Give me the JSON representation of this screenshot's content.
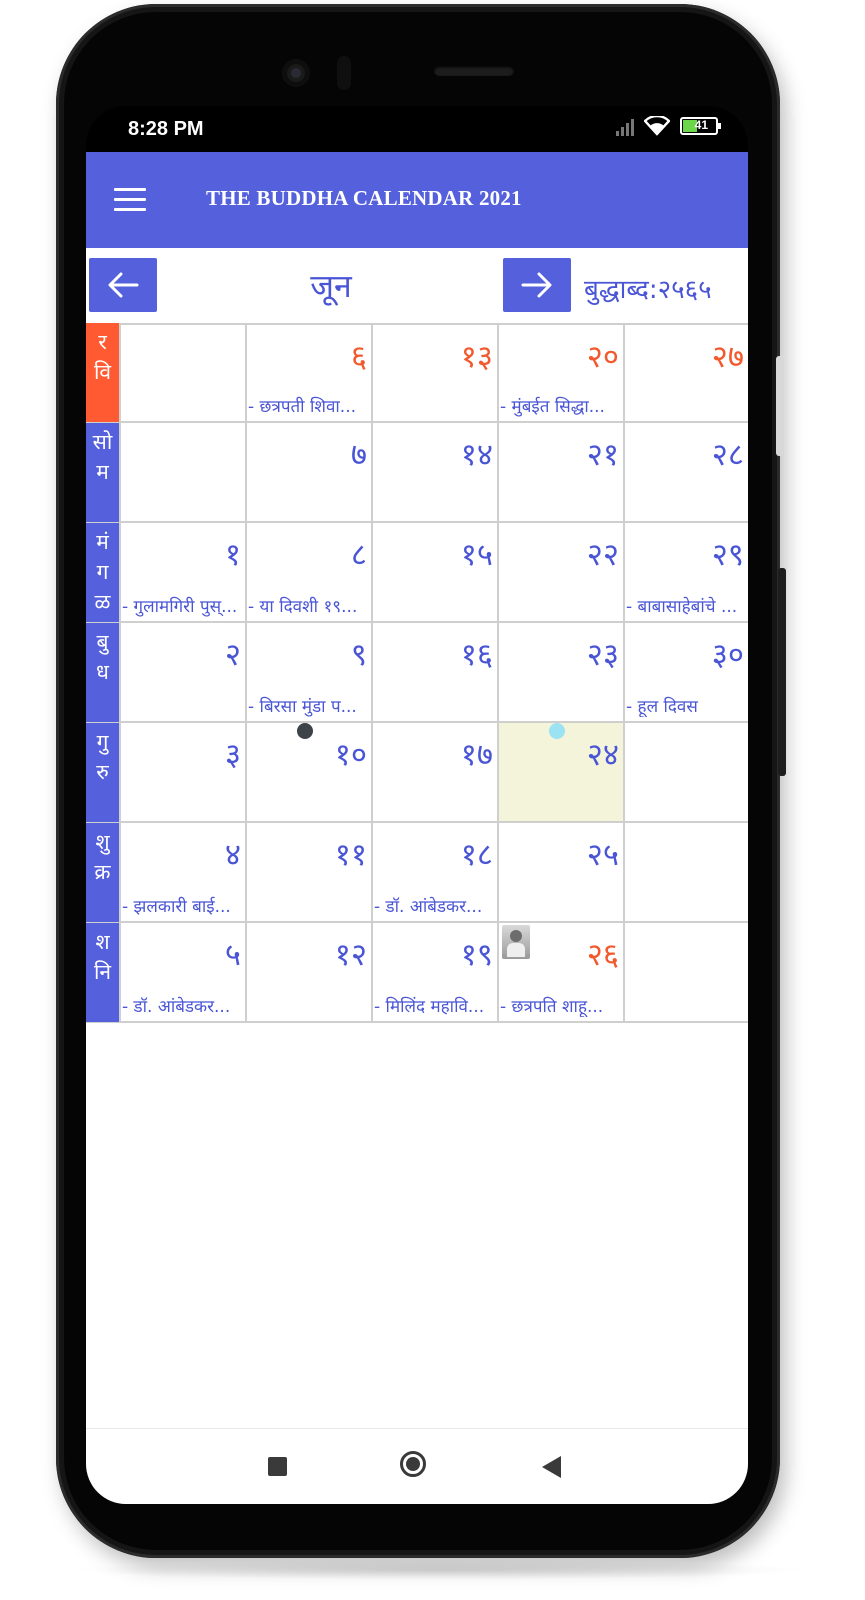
{
  "status": {
    "time": "8:28 PM",
    "battery": "41"
  },
  "appbar": {
    "title": "THE BUDDHA CALENDAR 2021"
  },
  "nav": {
    "month": "जून",
    "era": "बुद्धाब्द:२५६५"
  },
  "days": [
    {
      "label": "रवि",
      "chars": [
        "र",
        "वि"
      ],
      "sunday": true
    },
    {
      "label": "सोम",
      "chars": [
        "सो",
        "म"
      ],
      "sunday": false
    },
    {
      "label": "मंगळ",
      "chars": [
        "मं",
        "ग",
        "ळ"
      ],
      "sunday": false
    },
    {
      "label": "बुध",
      "chars": [
        "बु",
        "ध"
      ],
      "sunday": false
    },
    {
      "label": "गुरु",
      "chars": [
        "गु",
        "रु"
      ],
      "sunday": false
    },
    {
      "label": "शुक्र",
      "chars": [
        "शु",
        "क्र"
      ],
      "sunday": false
    },
    {
      "label": "शनि",
      "chars": [
        "श",
        "नि"
      ],
      "sunday": false
    }
  ],
  "rows": [
    [
      {
        "num": "",
        "event": ""
      },
      {
        "num": "६",
        "event": "- छत्रपती शिवा..."
      },
      {
        "num": "१३",
        "event": ""
      },
      {
        "num": "२०",
        "event": "- मुंबईत सिद्धा..."
      },
      {
        "num": "२७",
        "event": ""
      }
    ],
    [
      {
        "num": "",
        "event": ""
      },
      {
        "num": "७",
        "event": ""
      },
      {
        "num": "१४",
        "event": ""
      },
      {
        "num": "२१",
        "event": ""
      },
      {
        "num": "२८",
        "event": ""
      }
    ],
    [
      {
        "num": "१",
        "event": "- गुलामगिरी पुस्..."
      },
      {
        "num": "८",
        "event": "- या दिवशी १९..."
      },
      {
        "num": "१५",
        "event": ""
      },
      {
        "num": "२२",
        "event": ""
      },
      {
        "num": "२९",
        "event": "- बाबासाहेबांचे ..."
      }
    ],
    [
      {
        "num": "२",
        "event": ""
      },
      {
        "num": "९",
        "event": "- बिरसा मुंडा प..."
      },
      {
        "num": "१६",
        "event": ""
      },
      {
        "num": "२३",
        "event": ""
      },
      {
        "num": "३०",
        "event": "- हूल दिवस"
      }
    ],
    [
      {
        "num": "३",
        "event": ""
      },
      {
        "num": "१०",
        "event": ""
      },
      {
        "num": "१७",
        "event": ""
      },
      {
        "num": "२४",
        "event": ""
      },
      {
        "num": "",
        "event": ""
      }
    ],
    [
      {
        "num": "४",
        "event": "- झलकारी बाई..."
      },
      {
        "num": "११",
        "event": ""
      },
      {
        "num": "१८",
        "event": "- डॉ. आंबेडकर..."
      },
      {
        "num": "२५",
        "event": ""
      },
      {
        "num": "",
        "event": ""
      }
    ],
    [
      {
        "num": "५",
        "event": "- डॉ. आंबेडकर..."
      },
      {
        "num": "१२",
        "event": ""
      },
      {
        "num": "१९",
        "event": "- मिलिंद महावि..."
      },
      {
        "num": "२६",
        "event": "- छत्रपति शाहू..."
      },
      {
        "num": "",
        "event": ""
      }
    ]
  ],
  "colors": {
    "primary": "#5560dc",
    "sunday": "#ff5a32",
    "date_red": "#f25a2e",
    "today_bg": "#f4f4db"
  }
}
